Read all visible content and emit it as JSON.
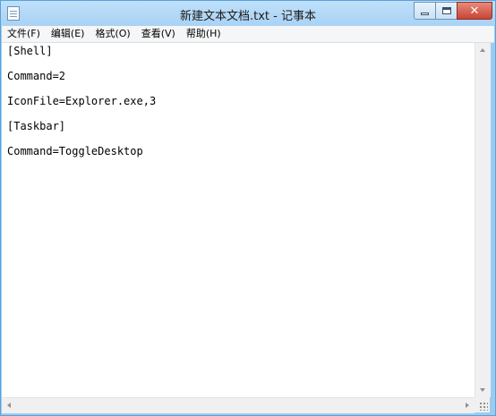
{
  "window": {
    "title": "新建文本文档.txt - 记事本",
    "controls": {
      "close_label": "✕"
    }
  },
  "menu": {
    "items": [
      {
        "label": "文件(F)"
      },
      {
        "label": "编辑(E)"
      },
      {
        "label": "格式(O)"
      },
      {
        "label": "查看(V)"
      },
      {
        "label": "帮助(H)"
      }
    ]
  },
  "editor": {
    "lines": [
      "[Shell]",
      "Command=2",
      "IconFile=Explorer.exe,3",
      "[Taskbar]",
      "Command=ToggleDesktop"
    ]
  }
}
